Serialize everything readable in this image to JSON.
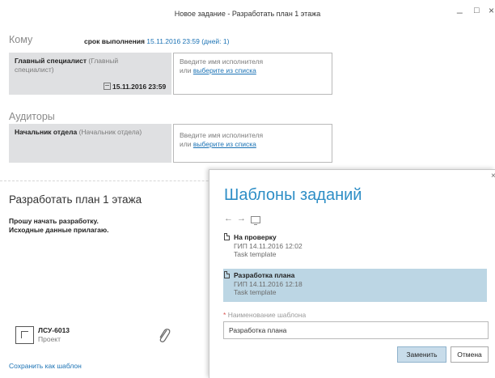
{
  "window": {
    "title": "Новое задание - Разработать план 1 этажа",
    "minimize_glyph": "_",
    "maximize_glyph": "□",
    "close_glyph": "×"
  },
  "to": {
    "header": "Кому",
    "deadline_label": "срок выполнения",
    "deadline_value": "15.11.2016 23:59",
    "deadline_days": "(дней: 1)",
    "assignee_name": "Главный специалист",
    "assignee_role": "(Главный специалист)",
    "assignee_date": "15.11.2016 23:59",
    "input_hint": "Введите имя исполнителя",
    "input_or": "или",
    "input_link": "выберите из списка"
  },
  "auditors": {
    "header": "Аудиторы",
    "auditor_name": "Начальник отдела",
    "auditor_role": "(Начальник отдела)",
    "input_hint": "Введите имя исполнителя",
    "input_or": "или",
    "input_link": "выберите из списка"
  },
  "task": {
    "title": "Разработать план 1 этажа",
    "body_line1": "Прошу начать разработку.",
    "body_line2": "Исходные данные прилагаю.",
    "project_code": "ЛСУ-6013",
    "project_label": "Проект",
    "save_template": "Сохранить как шаблон"
  },
  "templates_dialog": {
    "title": "Шаблоны заданий",
    "back_glyph": "←",
    "forward_glyph": "→",
    "close_glyph": "×",
    "items": [
      {
        "name": "На проверку",
        "meta": "ГИП 14.11.2016 12:02",
        "type": "Task template",
        "selected": false
      },
      {
        "name": "Разработка плана",
        "meta": "ГИП 14.11.2016 12:18",
        "type": "Task template",
        "selected": true
      }
    ],
    "name_required_mark": "*",
    "name_label": "Наименование шаблона",
    "name_value": "Разработка плана",
    "replace_button": "Заменить",
    "cancel_button": "Отмена"
  }
}
